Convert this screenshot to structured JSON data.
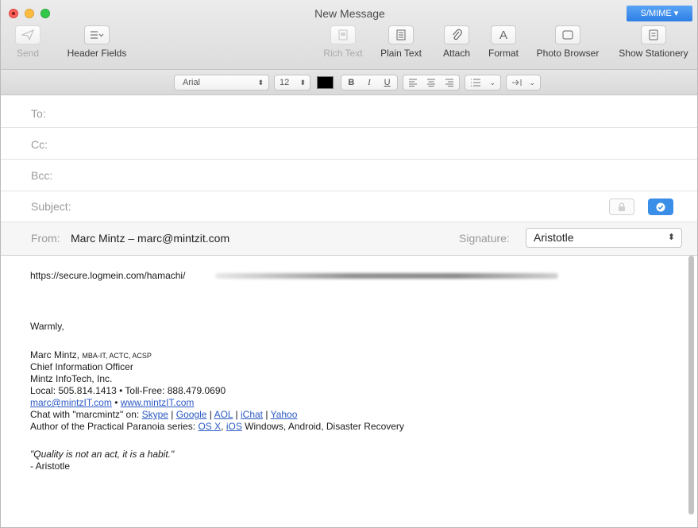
{
  "window": {
    "title": "New Message",
    "smime_label": "S/MIME ▾"
  },
  "toolbar": {
    "send_label": "Send",
    "header_fields_label": "Header Fields",
    "rich_text_label": "Rich Text",
    "plain_text_label": "Plain Text",
    "attach_label": "Attach",
    "format_label": "Format",
    "photo_browser_label": "Photo Browser",
    "show_stationery_label": "Show Stationery"
  },
  "format_bar": {
    "font": "Arial",
    "size": "12"
  },
  "fields": {
    "to_label": "To:",
    "cc_label": "Cc:",
    "bcc_label": "Bcc:",
    "subject_label": "Subject:",
    "from_label": "From:",
    "from_value": "Marc Mintz – marc@mintzit.com",
    "signature_label": "Signature:",
    "signature_value": "Aristotle"
  },
  "message": {
    "url_prefix": "https://secure.logmein.com/hamachi/",
    "greeting": "Warmly,",
    "name": "Marc Mintz,",
    "credentials": "MBA-IT, ACTC, ACSP",
    "title": "Chief Information Officer",
    "company": "Mintz InfoTech, Inc.",
    "phone_line": "Local: 505.814.1413  •  Toll-Free: 888.479.0690",
    "email_link": "marc@mintzIT.com",
    "bullet": "•",
    "web_link": "www.mintzIT.com",
    "chat_prefix": "Chat with \"marcmintz\" on:",
    "chat_links": [
      "Skype",
      "Google",
      "AOL",
      "iChat",
      "Yahoo"
    ],
    "separator": "|",
    "author_prefix": "Author of the Practical Paranoia series:",
    "author_link_1": "OS X",
    "author_link_2": "iOS",
    "author_suffix": "Windows, Android, Disaster Recovery",
    "quote": "\"Quality is not an act, it is a habit.\"",
    "quote_author": "- Aristotle"
  }
}
